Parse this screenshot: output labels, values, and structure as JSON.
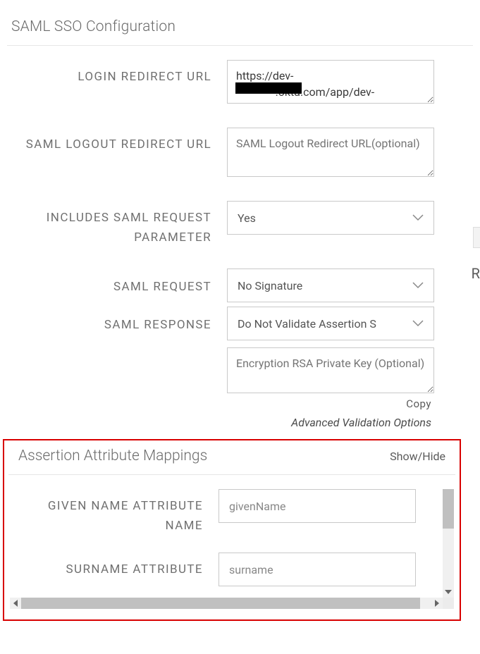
{
  "section_title": "SAML SSO Configuration",
  "fields": {
    "login_redirect": {
      "label": "LOGIN REDIRECT URL",
      "value": "https://dev-\n              .okta.com/app/dev-"
    },
    "logout_redirect": {
      "label": "SAML LOGOUT REDIRECT URL",
      "placeholder": "SAML Logout Redirect URL(optional)"
    },
    "includes_param": {
      "label": "INCLUDES SAML REQUEST PARAMETER",
      "value": "Yes"
    },
    "saml_request": {
      "label": "SAML REQUEST",
      "value": "No Signature"
    },
    "saml_response": {
      "label": "SAML RESPONSE",
      "value": "Do Not Validate Assertion S"
    },
    "encryption_key": {
      "placeholder": "Encryption RSA Private Key (Optional)"
    }
  },
  "copy_label": "Copy",
  "advanced_label": "Advanced Validation Options",
  "mappings": {
    "title": "Assertion Attribute Mappings",
    "toggle": "Show/Hide",
    "given_name": {
      "label": "GIVEN NAME ATTRIBUTE NAME",
      "value": "givenName"
    },
    "surname": {
      "label": "SURNAME ATTRIBUTE",
      "value": "surname"
    }
  },
  "edge_char": "R"
}
